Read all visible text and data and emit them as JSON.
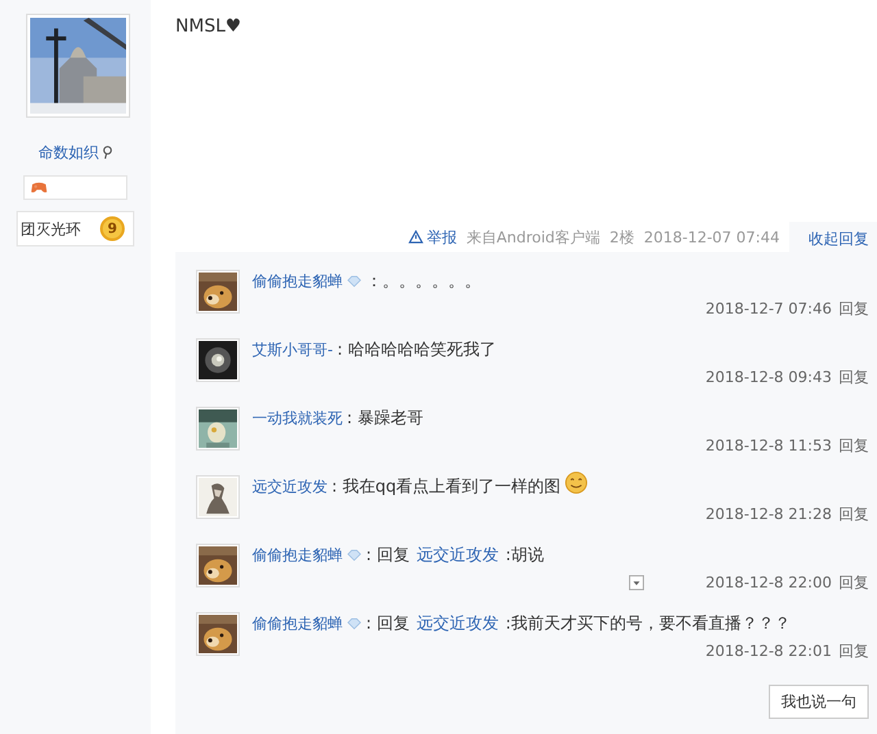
{
  "user": {
    "name": "命数如织",
    "title": "团灭光环",
    "level": "9"
  },
  "post": {
    "content": "NMSL♥"
  },
  "meta": {
    "report": "举报",
    "source": "来自Android客户端",
    "floor": "2楼",
    "time": "2018-12-07 07:44",
    "toggle": "收起回复"
  },
  "replies": [
    {
      "name": "偷偷抱走貂蝉",
      "vip": true,
      "text": "：。。。。。。",
      "emoji": false,
      "show_menu": false,
      "time": "2018-12-7 07:46",
      "action": "回复"
    },
    {
      "name": "艾斯小哥哥-",
      "vip": false,
      "text": ": 哈哈哈哈哈笑死我了",
      "emoji": false,
      "show_menu": false,
      "time": "2018-12-8 09:43",
      "action": "回复"
    },
    {
      "name": "一动我就装死",
      "vip": false,
      "text": ": 暴躁老哥",
      "emoji": false,
      "show_menu": false,
      "time": "2018-12-8 11:53",
      "action": "回复"
    },
    {
      "name": "远交近攻发",
      "vip": false,
      "text": ": 我在qq看点上看到了一样的图",
      "emoji": true,
      "show_menu": false,
      "time": "2018-12-8 21:28",
      "action": "回复"
    },
    {
      "name": "偷偷抱走貂蝉",
      "vip": true,
      "reply_prefix": ": 回复",
      "reply_to": "远交近攻发",
      "text": ":胡说",
      "emoji": false,
      "show_menu": true,
      "time": "2018-12-8 22:00",
      "action": "回复"
    },
    {
      "name": "偷偷抱走貂蝉",
      "vip": true,
      "reply_prefix": ": 回复",
      "reply_to": "远交近攻发",
      "text": ":我前天才买下的号，要不看直播？？？",
      "emoji": false,
      "show_menu": false,
      "time": "2018-12-8 22:01",
      "action": "回复"
    }
  ],
  "comment_button": "我也说一句"
}
